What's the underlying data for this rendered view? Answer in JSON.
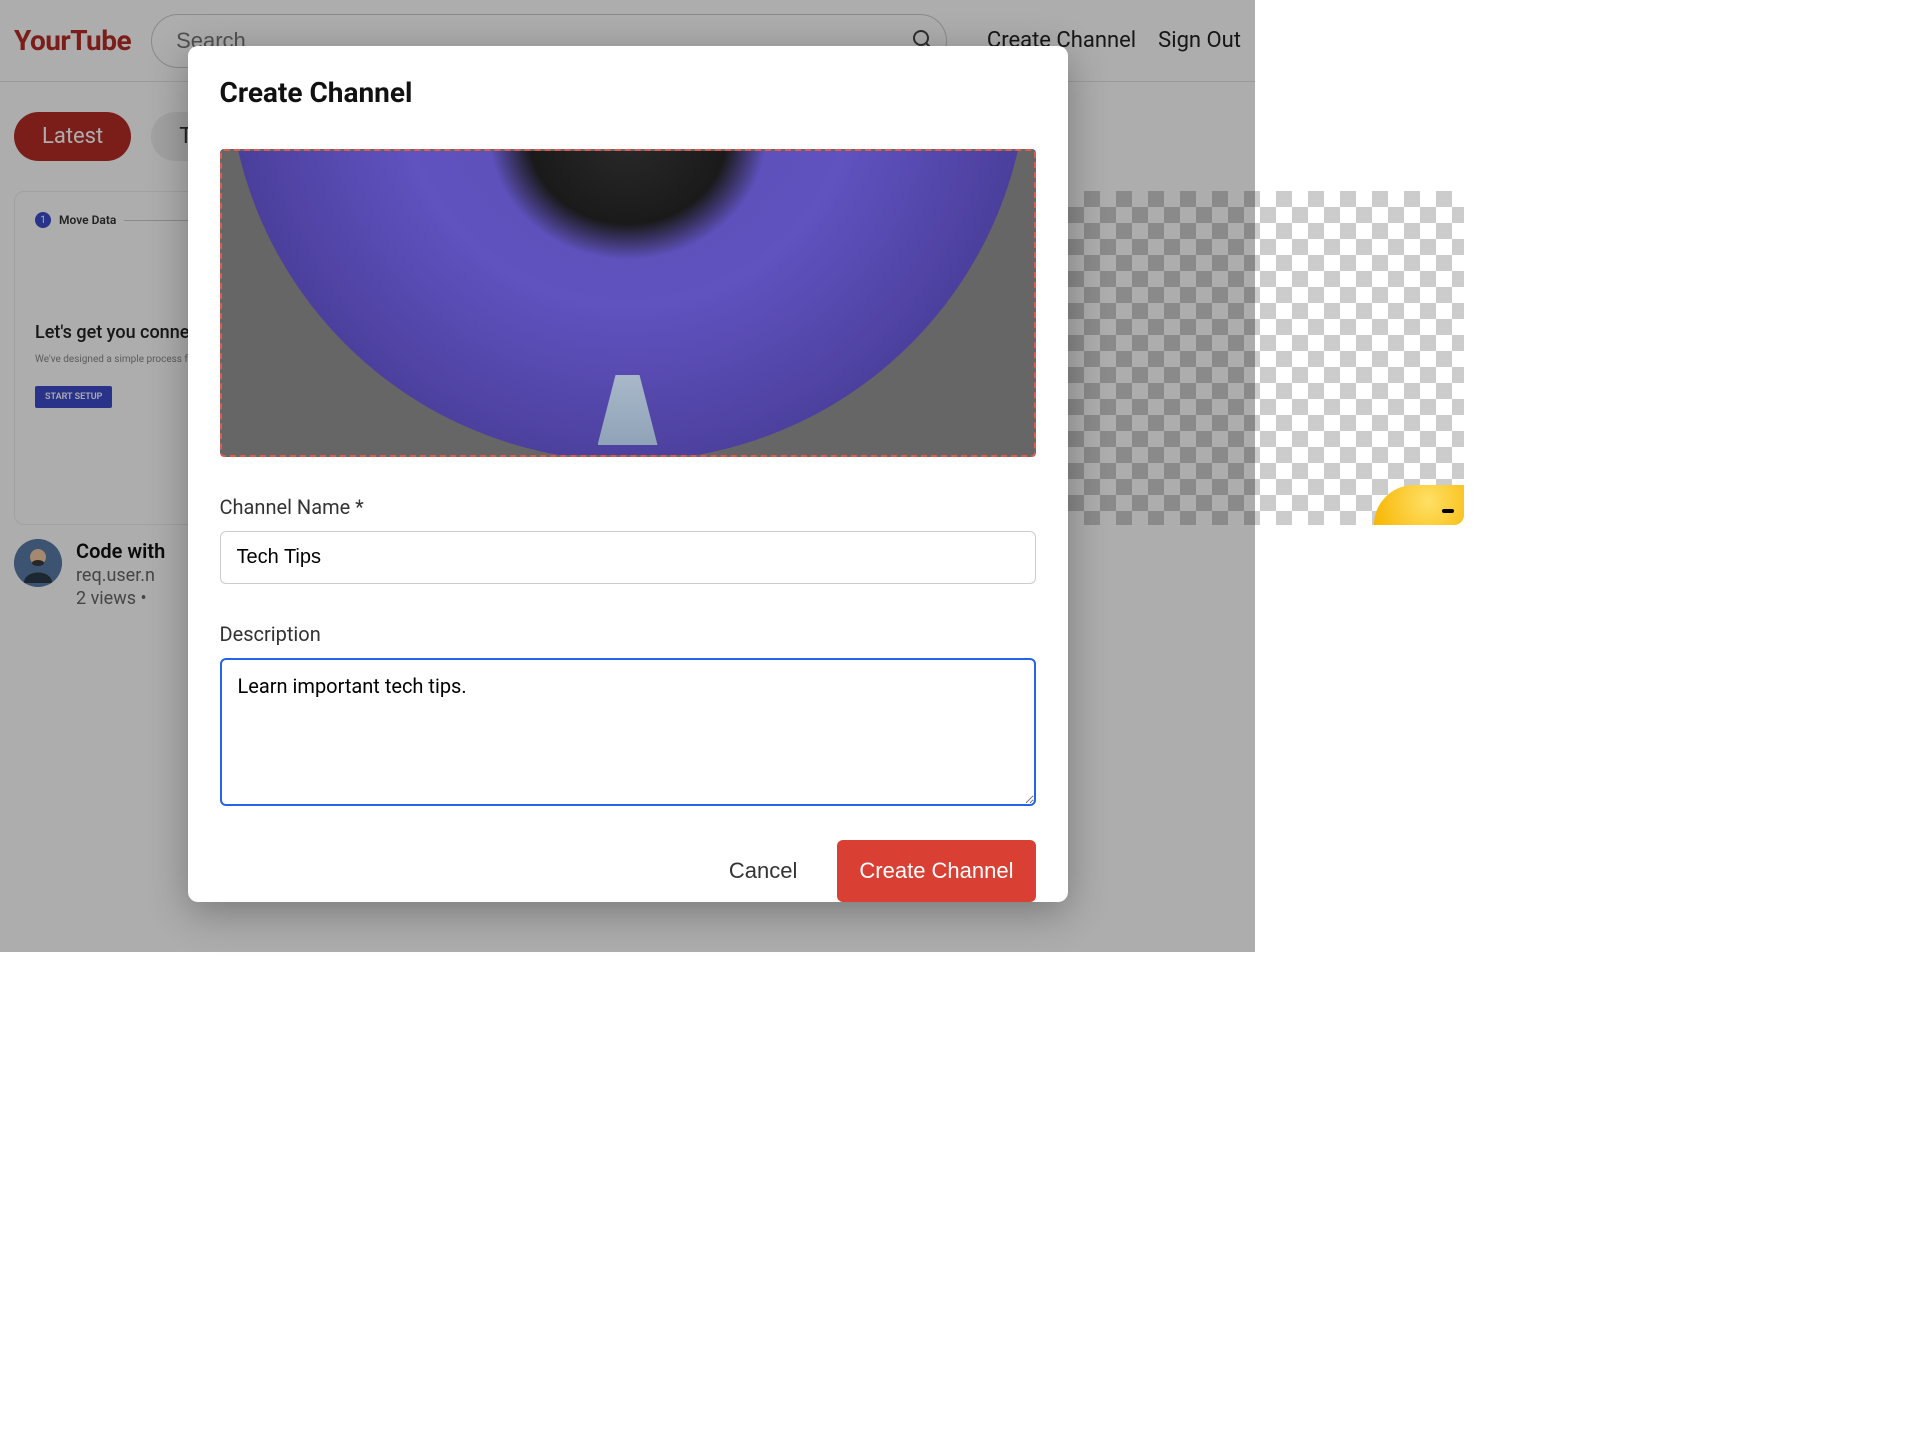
{
  "header": {
    "logo": "YourTube",
    "search_placeholder": "Search",
    "create_channel": "Create Channel",
    "sign_out": "Sign Out"
  },
  "filters": {
    "latest": "Latest",
    "trending": "Trending"
  },
  "videos": [
    {
      "thumb_badge_text": "Move Data",
      "thumb_heading": "Let's get you connected",
      "thumb_sub": "We've designed a simple process for completing setup. Here's how it works.",
      "thumb_button": "START SETUP",
      "title": "Code with",
      "channel": "req.user.n",
      "stats": "2 views •"
    },
    {
      "duration": ""
    }
  ],
  "modal": {
    "title": "Create Channel",
    "name_label": "Channel Name *",
    "name_value": "Tech Tips",
    "desc_label": "Description",
    "desc_value": "Learn important tech tips.",
    "cancel": "Cancel",
    "submit": "Create Channel"
  }
}
